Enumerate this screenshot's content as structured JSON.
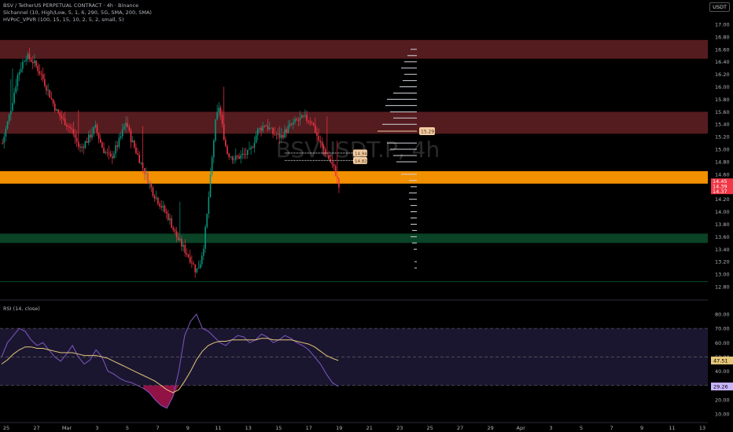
{
  "header": {
    "symbol_line": "BSV / TetherUS PERPETUAL CONTRACT · 4h · Binance",
    "indicator_1": "Slchannel (10, High/Low, 5, 1, 6, 290, 5G, SMA, 200, SMA)",
    "indicator_2": "HVPoC_VPVR (100, 15, 15, 10, 2, 5, 2, small, 5)",
    "currency": "USDT"
  },
  "watermark": "BSVUSDT.P, 4h",
  "rsi_panel": {
    "label": "RSI (14, close)",
    "ticks": [
      80,
      70,
      60,
      50,
      40,
      30,
      20,
      10
    ],
    "upper_band": 70,
    "middle_band": 50,
    "lower_band": 30,
    "rsi_value_label": "29.26",
    "ma_value_label": "47.51",
    "rsi_color": "#7e57c2",
    "ma_color": "#e5c77a"
  },
  "price_axis": {
    "ticks": [
      "17.00",
      "16.80",
      "16.60",
      "16.40",
      "16.20",
      "16.00",
      "15.80",
      "15.60",
      "15.40",
      "15.20",
      "15.00",
      "14.80",
      "14.60",
      "14.40",
      "14.20",
      "14.00",
      "13.80",
      "13.60",
      "13.40",
      "13.20",
      "13.00",
      "12.80"
    ],
    "last_price_label": "14.45",
    "last_price_sub1": "14.39",
    "last_price_sub2": "14.37"
  },
  "time_axis": {
    "labels": [
      "25",
      "27",
      "Mar",
      "3",
      "5",
      "7",
      "9",
      "11",
      "13",
      "15",
      "17",
      "19",
      "21",
      "23",
      "25",
      "27",
      "29",
      "Apr",
      "3",
      "5",
      "7",
      "9",
      "11",
      "13"
    ]
  },
  "annotations": {
    "poc_label": "15.29",
    "tag_1": "14.94",
    "tag_2": "14.82"
  },
  "chart_data": {
    "type": "candlestick",
    "title": "BSV / TetherUS PERPETUAL CONTRACT · 4h · Binance",
    "colors": {
      "up": "#089981",
      "down": "#f23645",
      "zone_red": "#5e1f22",
      "zone_orange": "#ff9800",
      "zone_green": "#0b4a2a"
    },
    "ylim": [
      12.7,
      17.1
    ],
    "zones": [
      {
        "name": "resistance-top",
        "from": 16.45,
        "to": 16.75,
        "color": "#5e1f22"
      },
      {
        "name": "resistance-mid",
        "from": 15.25,
        "to": 15.6,
        "color": "#5e1f22"
      },
      {
        "name": "support-orange",
        "from": 14.45,
        "to": 14.65,
        "color": "#ff9800"
      },
      {
        "name": "support-green",
        "from": 13.5,
        "to": 13.65,
        "color": "#0b4a2a"
      }
    ],
    "price_path": [
      [
        0,
        15.1
      ],
      [
        2,
        15.6
      ],
      [
        4,
        16.2
      ],
      [
        6,
        16.5
      ],
      [
        8,
        16.4
      ],
      [
        10,
        16.2
      ],
      [
        12,
        15.9
      ],
      [
        14,
        15.6
      ],
      [
        16,
        15.45
      ],
      [
        18,
        15.3
      ],
      [
        20,
        15.0
      ],
      [
        22,
        15.15
      ],
      [
        24,
        15.35
      ],
      [
        26,
        15.0
      ],
      [
        28,
        14.85
      ],
      [
        30,
        15.1
      ],
      [
        32,
        15.45
      ],
      [
        33,
        15.2
      ],
      [
        35,
        14.9
      ],
      [
        37,
        14.6
      ],
      [
        39,
        14.3
      ],
      [
        41,
        14.1
      ],
      [
        43,
        13.9
      ],
      [
        45,
        13.6
      ],
      [
        47,
        13.4
      ],
      [
        49,
        13.2
      ],
      [
        50,
        13.05
      ],
      [
        51,
        13.15
      ],
      [
        52,
        13.45
      ],
      [
        53,
        14.0
      ],
      [
        54,
        14.7
      ],
      [
        55,
        15.4
      ],
      [
        56,
        15.7
      ],
      [
        57,
        15.3
      ],
      [
        58,
        14.95
      ],
      [
        60,
        14.85
      ],
      [
        62,
        14.9
      ],
      [
        64,
        14.95
      ],
      [
        66,
        15.3
      ],
      [
        68,
        15.4
      ],
      [
        70,
        15.25
      ],
      [
        72,
        15.2
      ],
      [
        74,
        15.35
      ],
      [
        76,
        15.45
      ],
      [
        78,
        15.5
      ],
      [
        80,
        15.45
      ],
      [
        82,
        15.1
      ],
      [
        84,
        14.9
      ],
      [
        86,
        14.65
      ],
      [
        87,
        14.4
      ]
    ],
    "rsi": [
      50,
      60,
      65,
      70,
      68,
      62,
      58,
      60,
      55,
      50,
      47,
      52,
      58,
      50,
      45,
      48,
      55,
      50,
      40,
      38,
      35,
      33,
      32,
      30,
      28,
      25,
      20,
      16,
      14,
      22,
      40,
      65,
      75,
      80,
      70,
      68,
      64,
      60,
      58,
      62,
      65,
      64,
      60,
      62,
      66,
      64,
      60,
      62,
      65,
      63,
      60,
      58,
      55,
      50,
      45,
      38,
      32,
      29.26
    ],
    "rsi_ma": [
      45,
      48,
      52,
      55,
      57,
      57,
      56,
      56,
      55,
      54,
      53,
      53,
      53,
      52,
      51,
      51,
      51,
      50,
      49,
      47,
      45,
      43,
      41,
      39,
      37,
      35,
      33,
      30,
      27,
      25,
      27,
      33,
      40,
      48,
      54,
      58,
      60,
      61,
      61,
      62,
      62,
      62,
      62,
      62,
      63,
      63,
      62,
      62,
      62,
      62,
      61,
      60,
      59,
      57,
      54,
      51,
      49,
      47.51
    ]
  }
}
